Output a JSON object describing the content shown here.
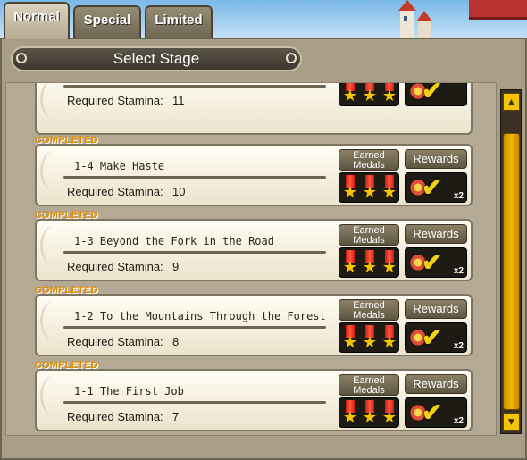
{
  "tabs": [
    {
      "label": "Normal",
      "active": true
    },
    {
      "label": "Special",
      "active": false
    },
    {
      "label": "Limited",
      "active": false
    }
  ],
  "header": {
    "title": "Select Stage"
  },
  "labels": {
    "completed": "COMPLETED",
    "earned_medals": "Earned Medals",
    "rewards": "Rewards",
    "required_stamina": "Required Stamina:",
    "multiplier": "x2"
  },
  "stages": [
    {
      "title": "",
      "stamina": "11",
      "completed": false,
      "medals": 3,
      "show_x2": false
    },
    {
      "title": "1-4 Make Haste",
      "stamina": "10",
      "completed": true,
      "medals": 3,
      "show_x2": true
    },
    {
      "title": "1-3 Beyond the Fork in the Road",
      "stamina": "9",
      "completed": true,
      "medals": 3,
      "show_x2": true
    },
    {
      "title": "1-2 To the Mountains Through the Forest",
      "stamina": "8",
      "completed": true,
      "medals": 3,
      "show_x2": true
    },
    {
      "title": "1-1 The First Job",
      "stamina": "7",
      "completed": true,
      "medals": 3,
      "show_x2": true
    }
  ],
  "icons": {
    "medal": "medal-icon",
    "reward": "reward-check-icon",
    "scroll_up": "arrow-up-icon",
    "scroll_down": "arrow-down-icon"
  },
  "colors": {
    "completed_text": "#e08a00",
    "scroll_thumb": "#f2b700",
    "medal_ribbon": "#d01a1a",
    "medal_star": "#f7c400"
  }
}
